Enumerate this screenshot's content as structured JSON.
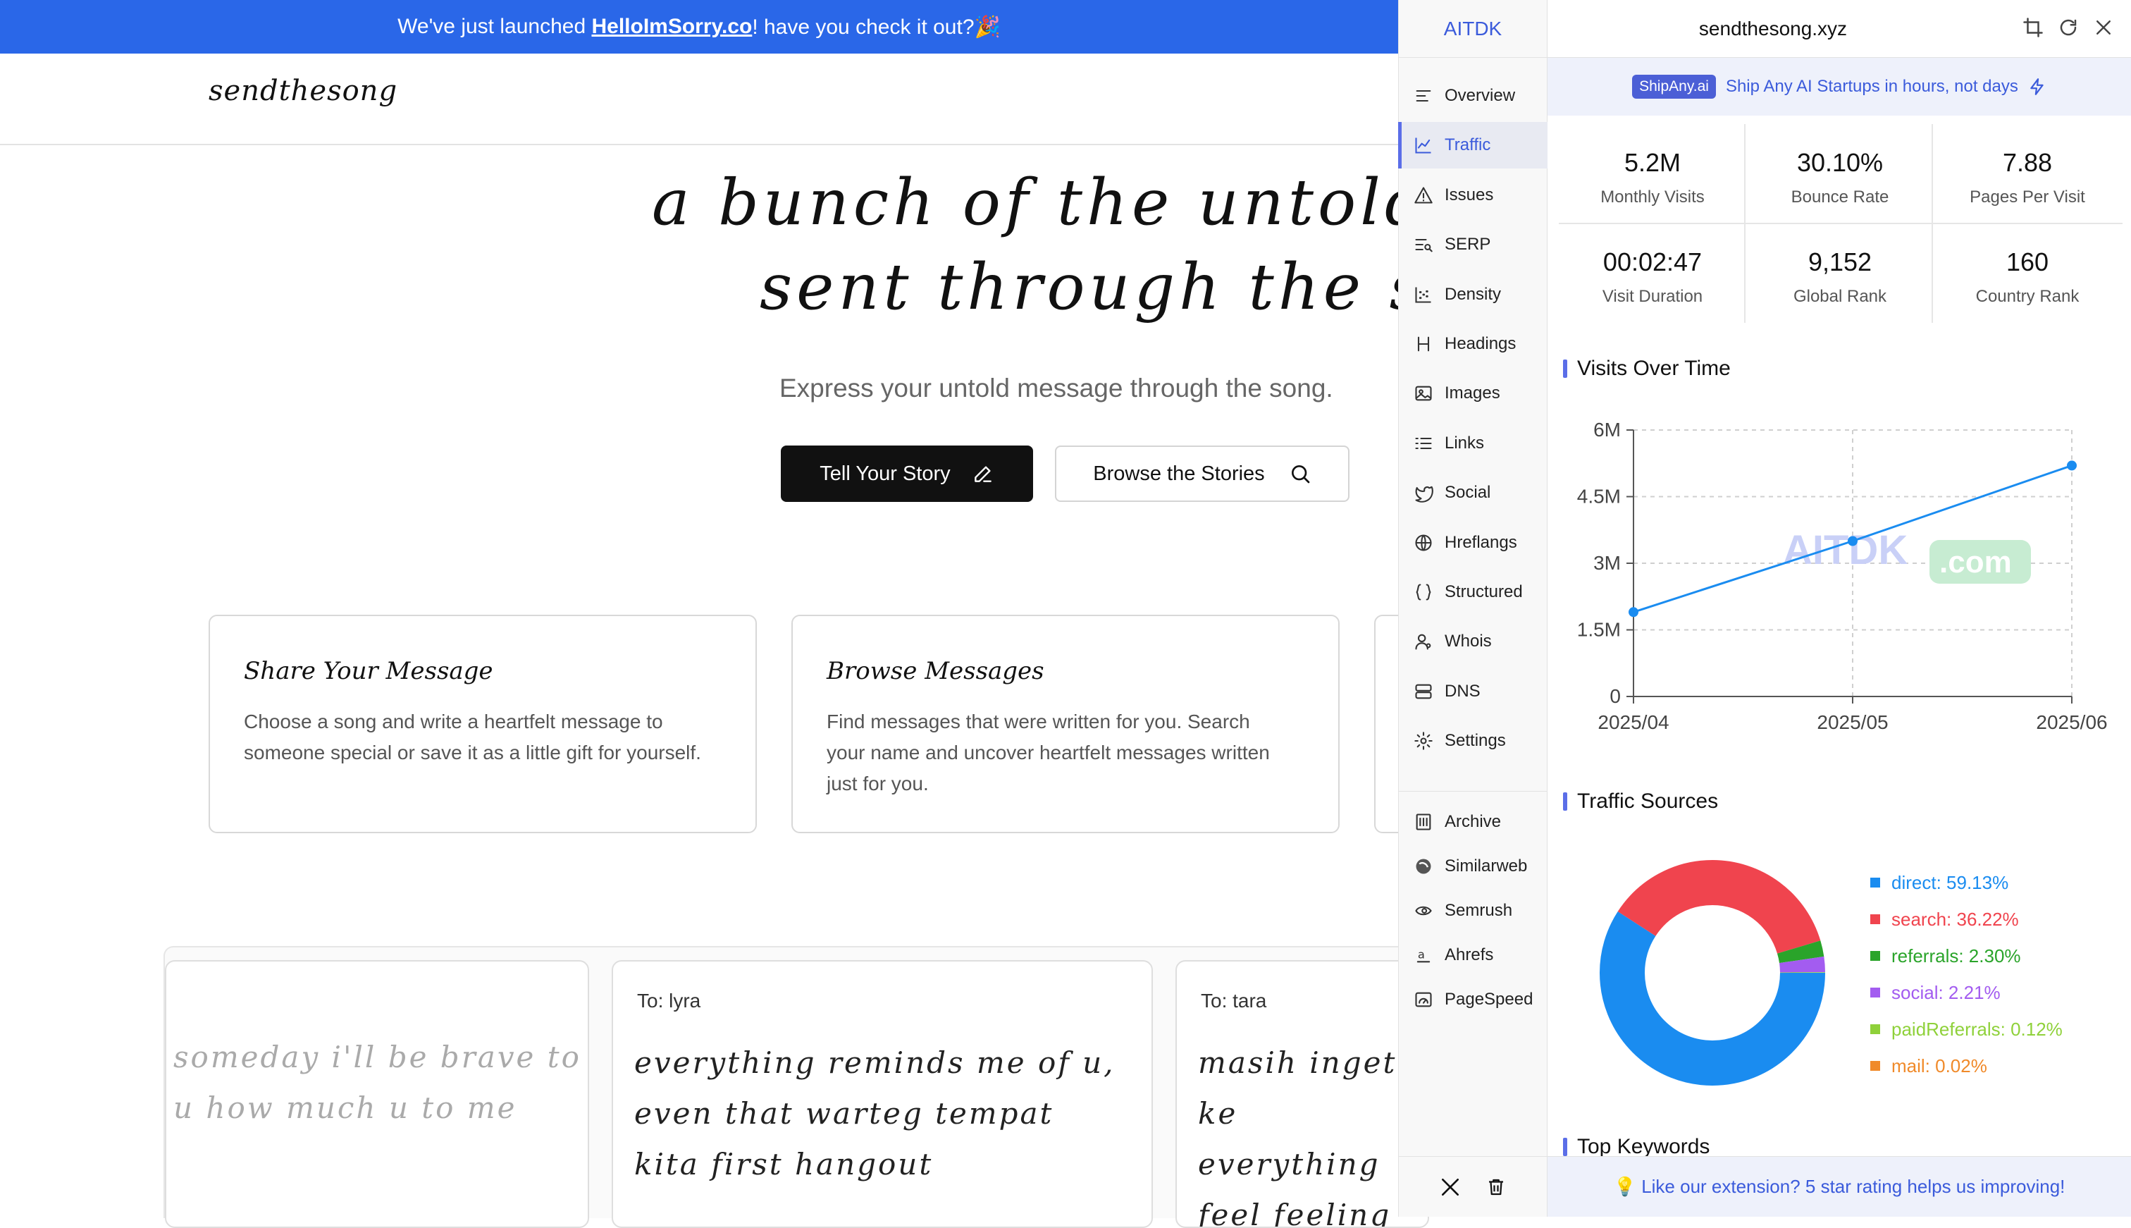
{
  "site": {
    "banner": {
      "prefix": "We've just launched ",
      "link": "HelloImSorry.co",
      "suffix": "! have you check it out?🎉"
    },
    "logo": "sendthesong",
    "hero": {
      "line1": "a bunch of the untold words",
      "line2": "sent through the song"
    },
    "tagline": "Express your untold message through the song.",
    "buttons": {
      "primary": "Tell Your Story",
      "secondary": "Browse the Stories"
    },
    "features": [
      {
        "title": "Share Your Message",
        "body": "Choose a song and write a heartfelt message to someone special or save it as a little gift for yourself."
      },
      {
        "title": "Browse Messages",
        "body": "Find messages that were written for you. Search your name and uncover heartfelt messages written just for you."
      }
    ],
    "messages": [
      {
        "to": "",
        "text": "someday i'll be brave to tell u how much u to me"
      },
      {
        "to": "To: lyra",
        "text": "everything reminds me of u, even that warteg tempat kita first hangout"
      },
      {
        "to": "To: tara",
        "text": "masih inget ke everything feel feeling"
      }
    ]
  },
  "extension": {
    "brand": "AITDK",
    "domain": "sendthesong.xyz",
    "promo": {
      "tag": "ShipAny.ai",
      "text": "Ship Any AI Startups in hours, not days"
    },
    "nav": [
      {
        "label": "Overview",
        "icon": "overview-icon"
      },
      {
        "label": "Traffic",
        "icon": "traffic-icon",
        "active": true
      },
      {
        "label": "Issues",
        "icon": "warning-icon"
      },
      {
        "label": "SERP",
        "icon": "serp-icon"
      },
      {
        "label": "Density",
        "icon": "density-icon"
      },
      {
        "label": "Headings",
        "icon": "heading-icon"
      },
      {
        "label": "Images",
        "icon": "image-icon"
      },
      {
        "label": "Links",
        "icon": "links-icon"
      },
      {
        "label": "Social",
        "icon": "bird-icon"
      },
      {
        "label": "Hreflangs",
        "icon": "globe-icon"
      },
      {
        "label": "Structured",
        "icon": "braces-icon"
      },
      {
        "label": "Whois",
        "icon": "user-icon"
      },
      {
        "label": "DNS",
        "icon": "server-icon"
      },
      {
        "label": "Settings",
        "icon": "gear-icon"
      }
    ],
    "tools": [
      {
        "label": "Archive",
        "icon": "archive-icon"
      },
      {
        "label": "Similarweb",
        "icon": "similarweb-icon"
      },
      {
        "label": "Semrush",
        "icon": "semrush-icon"
      },
      {
        "label": "Ahrefs",
        "icon": "ahrefs-icon"
      },
      {
        "label": "PageSpeed",
        "icon": "speed-icon"
      }
    ],
    "stats": [
      {
        "value": "5.2M",
        "label": "Monthly Visits"
      },
      {
        "value": "30.10%",
        "label": "Bounce Rate"
      },
      {
        "value": "7.88",
        "label": "Pages Per Visit"
      },
      {
        "value": "00:02:47",
        "label": "Visit Duration"
      },
      {
        "value": "9,152",
        "label": "Global Rank"
      },
      {
        "value": "160",
        "label": "Country Rank"
      }
    ],
    "visits_title": "Visits Over Time",
    "sources_title": "Traffic Sources",
    "keywords_title": "Top Keywords",
    "watermark": {
      "main": "AITDK",
      "suffix": ".com"
    },
    "rating": "💡 Like our extension? 5 star rating helps us improving!"
  },
  "chart_data": [
    {
      "type": "line",
      "title": "Visits Over Time",
      "x": [
        "2025/04",
        "2025/05",
        "2025/06"
      ],
      "series": [
        {
          "values": [
            1900000,
            3500000,
            5200000
          ]
        }
      ],
      "yticks": [
        "0",
        "1.5M",
        "3M",
        "4.5M",
        "6M"
      ],
      "ylim": [
        0,
        6000000
      ],
      "grid": true,
      "color": "#1a8cf0"
    },
    {
      "type": "pie",
      "title": "Traffic Sources",
      "donut": true,
      "slices": [
        {
          "name": "direct",
          "value": 59.13,
          "label": "direct: 59.13%",
          "color": "#1a8cf0"
        },
        {
          "name": "search",
          "value": 36.22,
          "label": "search: 36.22%",
          "color": "#f0444e"
        },
        {
          "name": "referrals",
          "value": 2.3,
          "label": "referrals: 2.30%",
          "color": "#2aa42a"
        },
        {
          "name": "social",
          "value": 2.21,
          "label": "social: 2.21%",
          "color": "#a35cf0"
        },
        {
          "name": "paidReferrals",
          "value": 0.12,
          "label": "paidReferrals: 0.12%",
          "color": "#8fd13a"
        },
        {
          "name": "mail",
          "value": 0.02,
          "label": "mail: 0.02%",
          "color": "#f08a2a"
        }
      ],
      "legend": "right"
    }
  ]
}
